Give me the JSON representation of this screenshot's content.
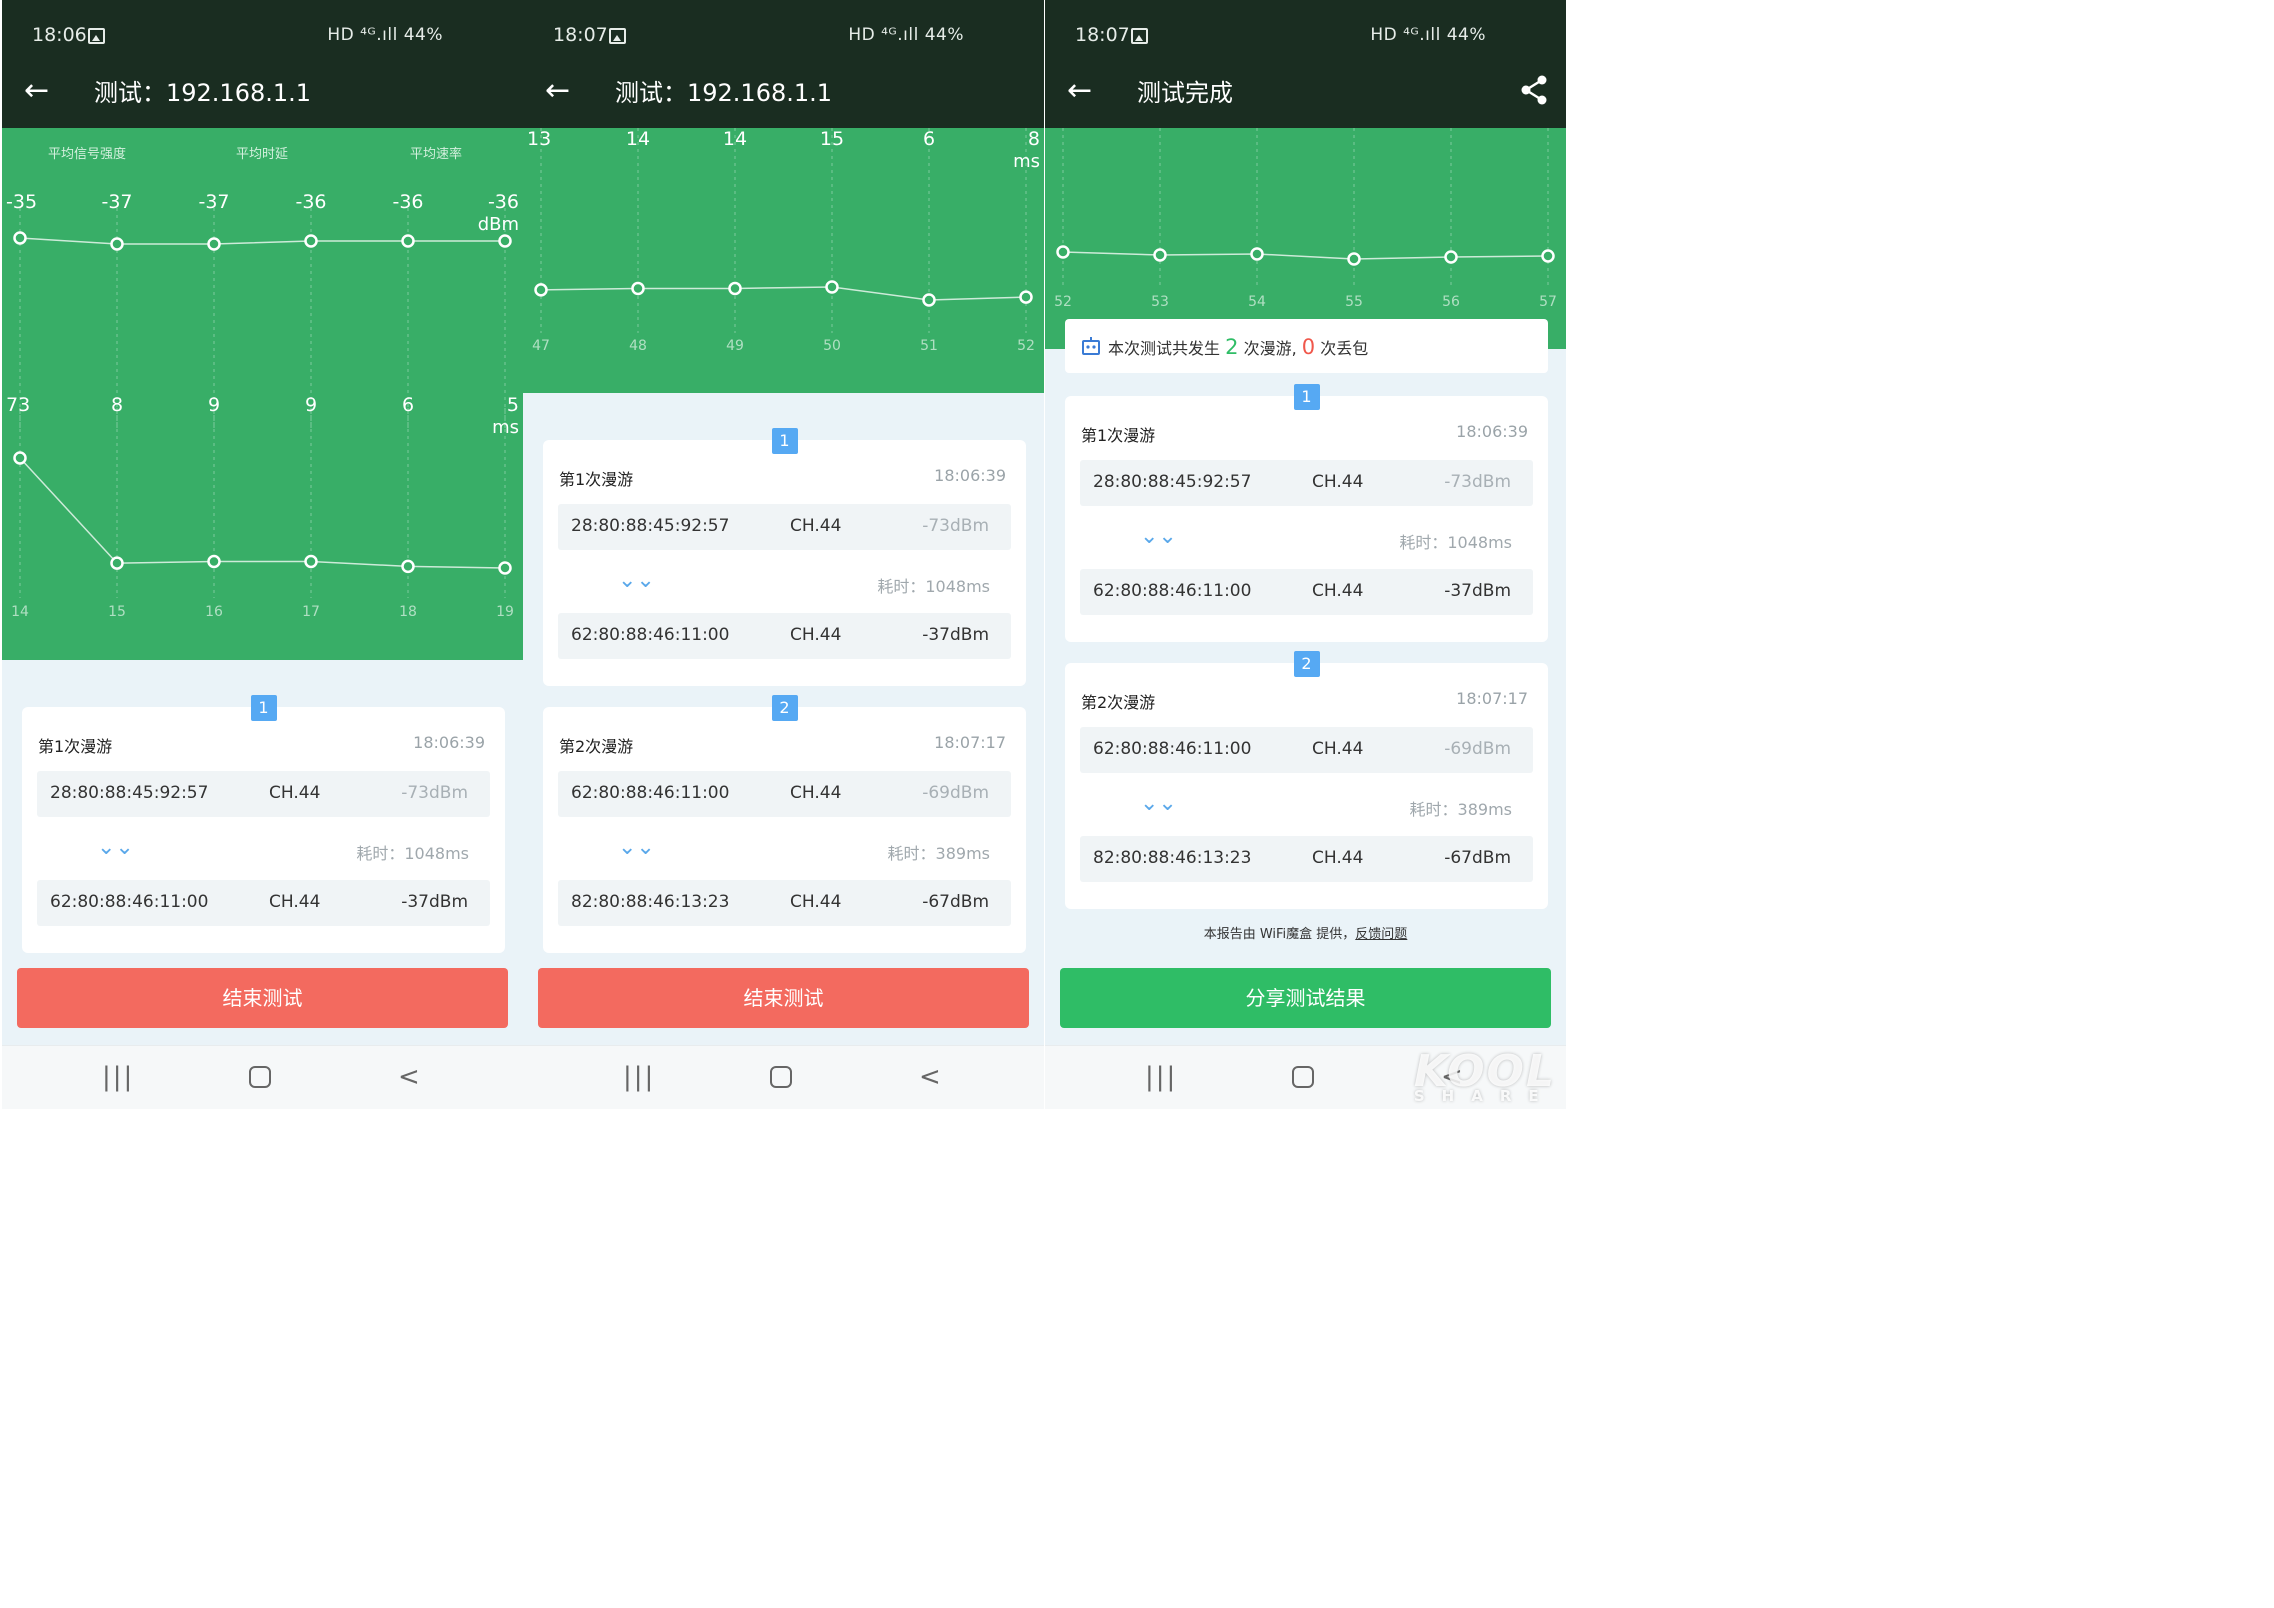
{
  "screens": [
    {
      "status": {
        "time": "18:06",
        "sys": "HD ⁴ᴳ.ıll 44%"
      },
      "appbar": {
        "title": "测试：192.168.1.1"
      },
      "header_labels": [
        "平均信号强度",
        "平均时延",
        "平均速率"
      ],
      "charts": [
        {
          "type": "line",
          "name": "signal",
          "x": [
            "",
            "",
            "",
            "",
            "",
            ""
          ],
          "values": [
            -35,
            -37,
            -37,
            -36,
            -36,
            -36
          ],
          "unit": "dBm",
          "labels": [
            "-35",
            "-37",
            "-37",
            "-36",
            "-36",
            "-36"
          ]
        },
        {
          "type": "line",
          "name": "latency",
          "x": [
            "14",
            "15",
            "16",
            "17",
            "18",
            "19"
          ],
          "values": [
            73,
            8,
            9,
            9,
            6,
            5
          ],
          "unit": "ms",
          "labels": [
            "73",
            "8",
            "9",
            "9",
            "6",
            "5"
          ]
        }
      ],
      "roams": [
        {
          "badge": "1",
          "title": "第1次漫游",
          "time": "18:06:39",
          "from": {
            "mac": "28:80:88:45:92:57",
            "ch": "CH.44",
            "dbm": "-73dBm"
          },
          "cost": "耗时：1048ms",
          "to": {
            "mac": "62:80:88:46:11:00",
            "ch": "CH.44",
            "dbm": "-37dBm"
          }
        }
      ],
      "button": "结束测试"
    },
    {
      "status": {
        "time": "18:07",
        "sys": "HD ⁴ᴳ.ıll 44%"
      },
      "appbar": {
        "title": "测试：192.168.1.1"
      },
      "charts": [
        {
          "type": "line",
          "name": "latency",
          "x": [
            "47",
            "48",
            "49",
            "50",
            "51",
            "52"
          ],
          "values": [
            13,
            14,
            14,
            15,
            6,
            8
          ],
          "unit": "ms",
          "labels": [
            "13",
            "14",
            "14",
            "15",
            "6",
            "8"
          ]
        }
      ],
      "roams": [
        {
          "badge": "1",
          "title": "第1次漫游",
          "time": "18:06:39",
          "from": {
            "mac": "28:80:88:45:92:57",
            "ch": "CH.44",
            "dbm": "-73dBm"
          },
          "cost": "耗时：1048ms",
          "to": {
            "mac": "62:80:88:46:11:00",
            "ch": "CH.44",
            "dbm": "-37dBm"
          }
        },
        {
          "badge": "2",
          "title": "第2次漫游",
          "time": "18:07:17",
          "from": {
            "mac": "62:80:88:46:11:00",
            "ch": "CH.44",
            "dbm": "-69dBm"
          },
          "cost": "耗时：389ms",
          "to": {
            "mac": "82:80:88:46:13:23",
            "ch": "CH.44",
            "dbm": "-67dBm"
          }
        }
      ],
      "button": "结束测试"
    },
    {
      "status": {
        "time": "18:07",
        "sys": "HD ⁴ᴳ.ıll 44%"
      },
      "appbar": {
        "title": "测试完成"
      },
      "charts": [
        {
          "type": "line",
          "name": "trend",
          "x": [
            "52",
            "53",
            "54",
            "55",
            "56",
            "57"
          ],
          "values": [
            null,
            null,
            null,
            null,
            null,
            null
          ],
          "labels": []
        }
      ],
      "summary": {
        "prefix": "本次测试共发生",
        "roam_count": "2",
        "mid": "次漫游,",
        "loss_count": "0",
        "suffix": "次丢包"
      },
      "roams": [
        {
          "badge": "1",
          "title": "第1次漫游",
          "time": "18:06:39",
          "from": {
            "mac": "28:80:88:45:92:57",
            "ch": "CH.44",
            "dbm": "-73dBm"
          },
          "cost": "耗时：1048ms",
          "to": {
            "mac": "62:80:88:46:11:00",
            "ch": "CH.44",
            "dbm": "-37dBm"
          }
        },
        {
          "badge": "2",
          "title": "第2次漫游",
          "time": "18:07:17",
          "from": {
            "mac": "62:80:88:46:11:00",
            "ch": "CH.44",
            "dbm": "-69dBm"
          },
          "cost": "耗时：389ms",
          "to": {
            "mac": "82:80:88:46:13:23",
            "ch": "CH.44",
            "dbm": "-67dBm"
          }
        }
      ],
      "footer": {
        "text": "本报告由 WiFi魔盒 提供，",
        "link": "反馈问题"
      },
      "button": "分享测试结果"
    }
  ],
  "watermark": {
    "main": "KOOL",
    "sub": "SHARE"
  },
  "colors": {
    "topbar": "#1a2d21",
    "chart_bg": "#38ae67",
    "end_button": "#f36a5f",
    "share_button": "#2fbd66",
    "badge": "#56a9f3"
  }
}
